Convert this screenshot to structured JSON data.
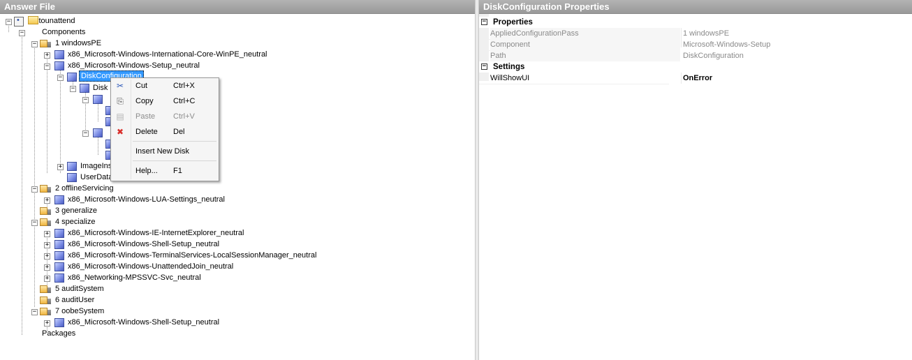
{
  "left_panel": {
    "title": "Answer File"
  },
  "right_panel": {
    "title": "DiskConfiguration Properties"
  },
  "tree": {
    "root": "Autounattend",
    "components": "Components",
    "pass1": "1 windowsPE",
    "intl_core": "x86_Microsoft-Windows-International-Core-WinPE_neutral",
    "setup": "x86_Microsoft-Windows-Setup_neutral",
    "disk_config": "DiskConfiguration",
    "disk": "Disk",
    "image_install": "ImageIns",
    "user_data": "UserData",
    "pass2": "2 offlineServicing",
    "lua": "x86_Microsoft-Windows-LUA-Settings_neutral",
    "pass3": "3 generalize",
    "pass4": "4 specialize",
    "ie": "x86_Microsoft-Windows-IE-InternetExplorer_neutral",
    "shell_setup": "x86_Microsoft-Windows-Shell-Setup_neutral",
    "terminal": "x86_Microsoft-Windows-TerminalServices-LocalSessionManager_neutral",
    "join": "x86_Microsoft-Windows-UnattendedJoin_neutral",
    "mpssvc": "x86_Networking-MPSSVC-Svc_neutral",
    "pass5": "5 auditSystem",
    "pass6": "6 auditUser",
    "pass7": "7 oobeSystem",
    "shell_setup_oobe": "x86_Microsoft-Windows-Shell-Setup_neutral",
    "packages": "Packages"
  },
  "context_menu": {
    "items": [
      {
        "label": "Cut",
        "shortcut": "Ctrl+X",
        "icon": "scissors-icon"
      },
      {
        "label": "Copy",
        "shortcut": "Ctrl+C",
        "icon": "copy-icon"
      },
      {
        "label": "Paste",
        "shortcut": "Ctrl+V",
        "icon": "paste-icon",
        "disabled": true
      },
      {
        "label": "Delete",
        "shortcut": "Del",
        "icon": "delete-icon"
      },
      {
        "label": "Insert New Disk",
        "shortcut": ""
      },
      {
        "label": "Help...",
        "shortcut": "F1"
      }
    ]
  },
  "properties": {
    "cat_properties": "Properties",
    "cat_settings": "Settings",
    "rows": [
      {
        "name": "AppliedConfigurationPass",
        "value": "1 windowsPE"
      },
      {
        "name": "Component",
        "value": "Microsoft-Windows-Setup"
      },
      {
        "name": "Path",
        "value": "DiskConfiguration"
      }
    ],
    "setting_rows": [
      {
        "name": "WillShowUI",
        "value": "OnError"
      }
    ]
  },
  "icons": {
    "collapse": "−",
    "expand": "+",
    "cut": "✂",
    "copy": "⎘",
    "paste": "▤",
    "delete": "✖"
  },
  "colors": {
    "selection": "#3399ff",
    "header": "#a6a6a6",
    "delete": "#d9302c"
  }
}
